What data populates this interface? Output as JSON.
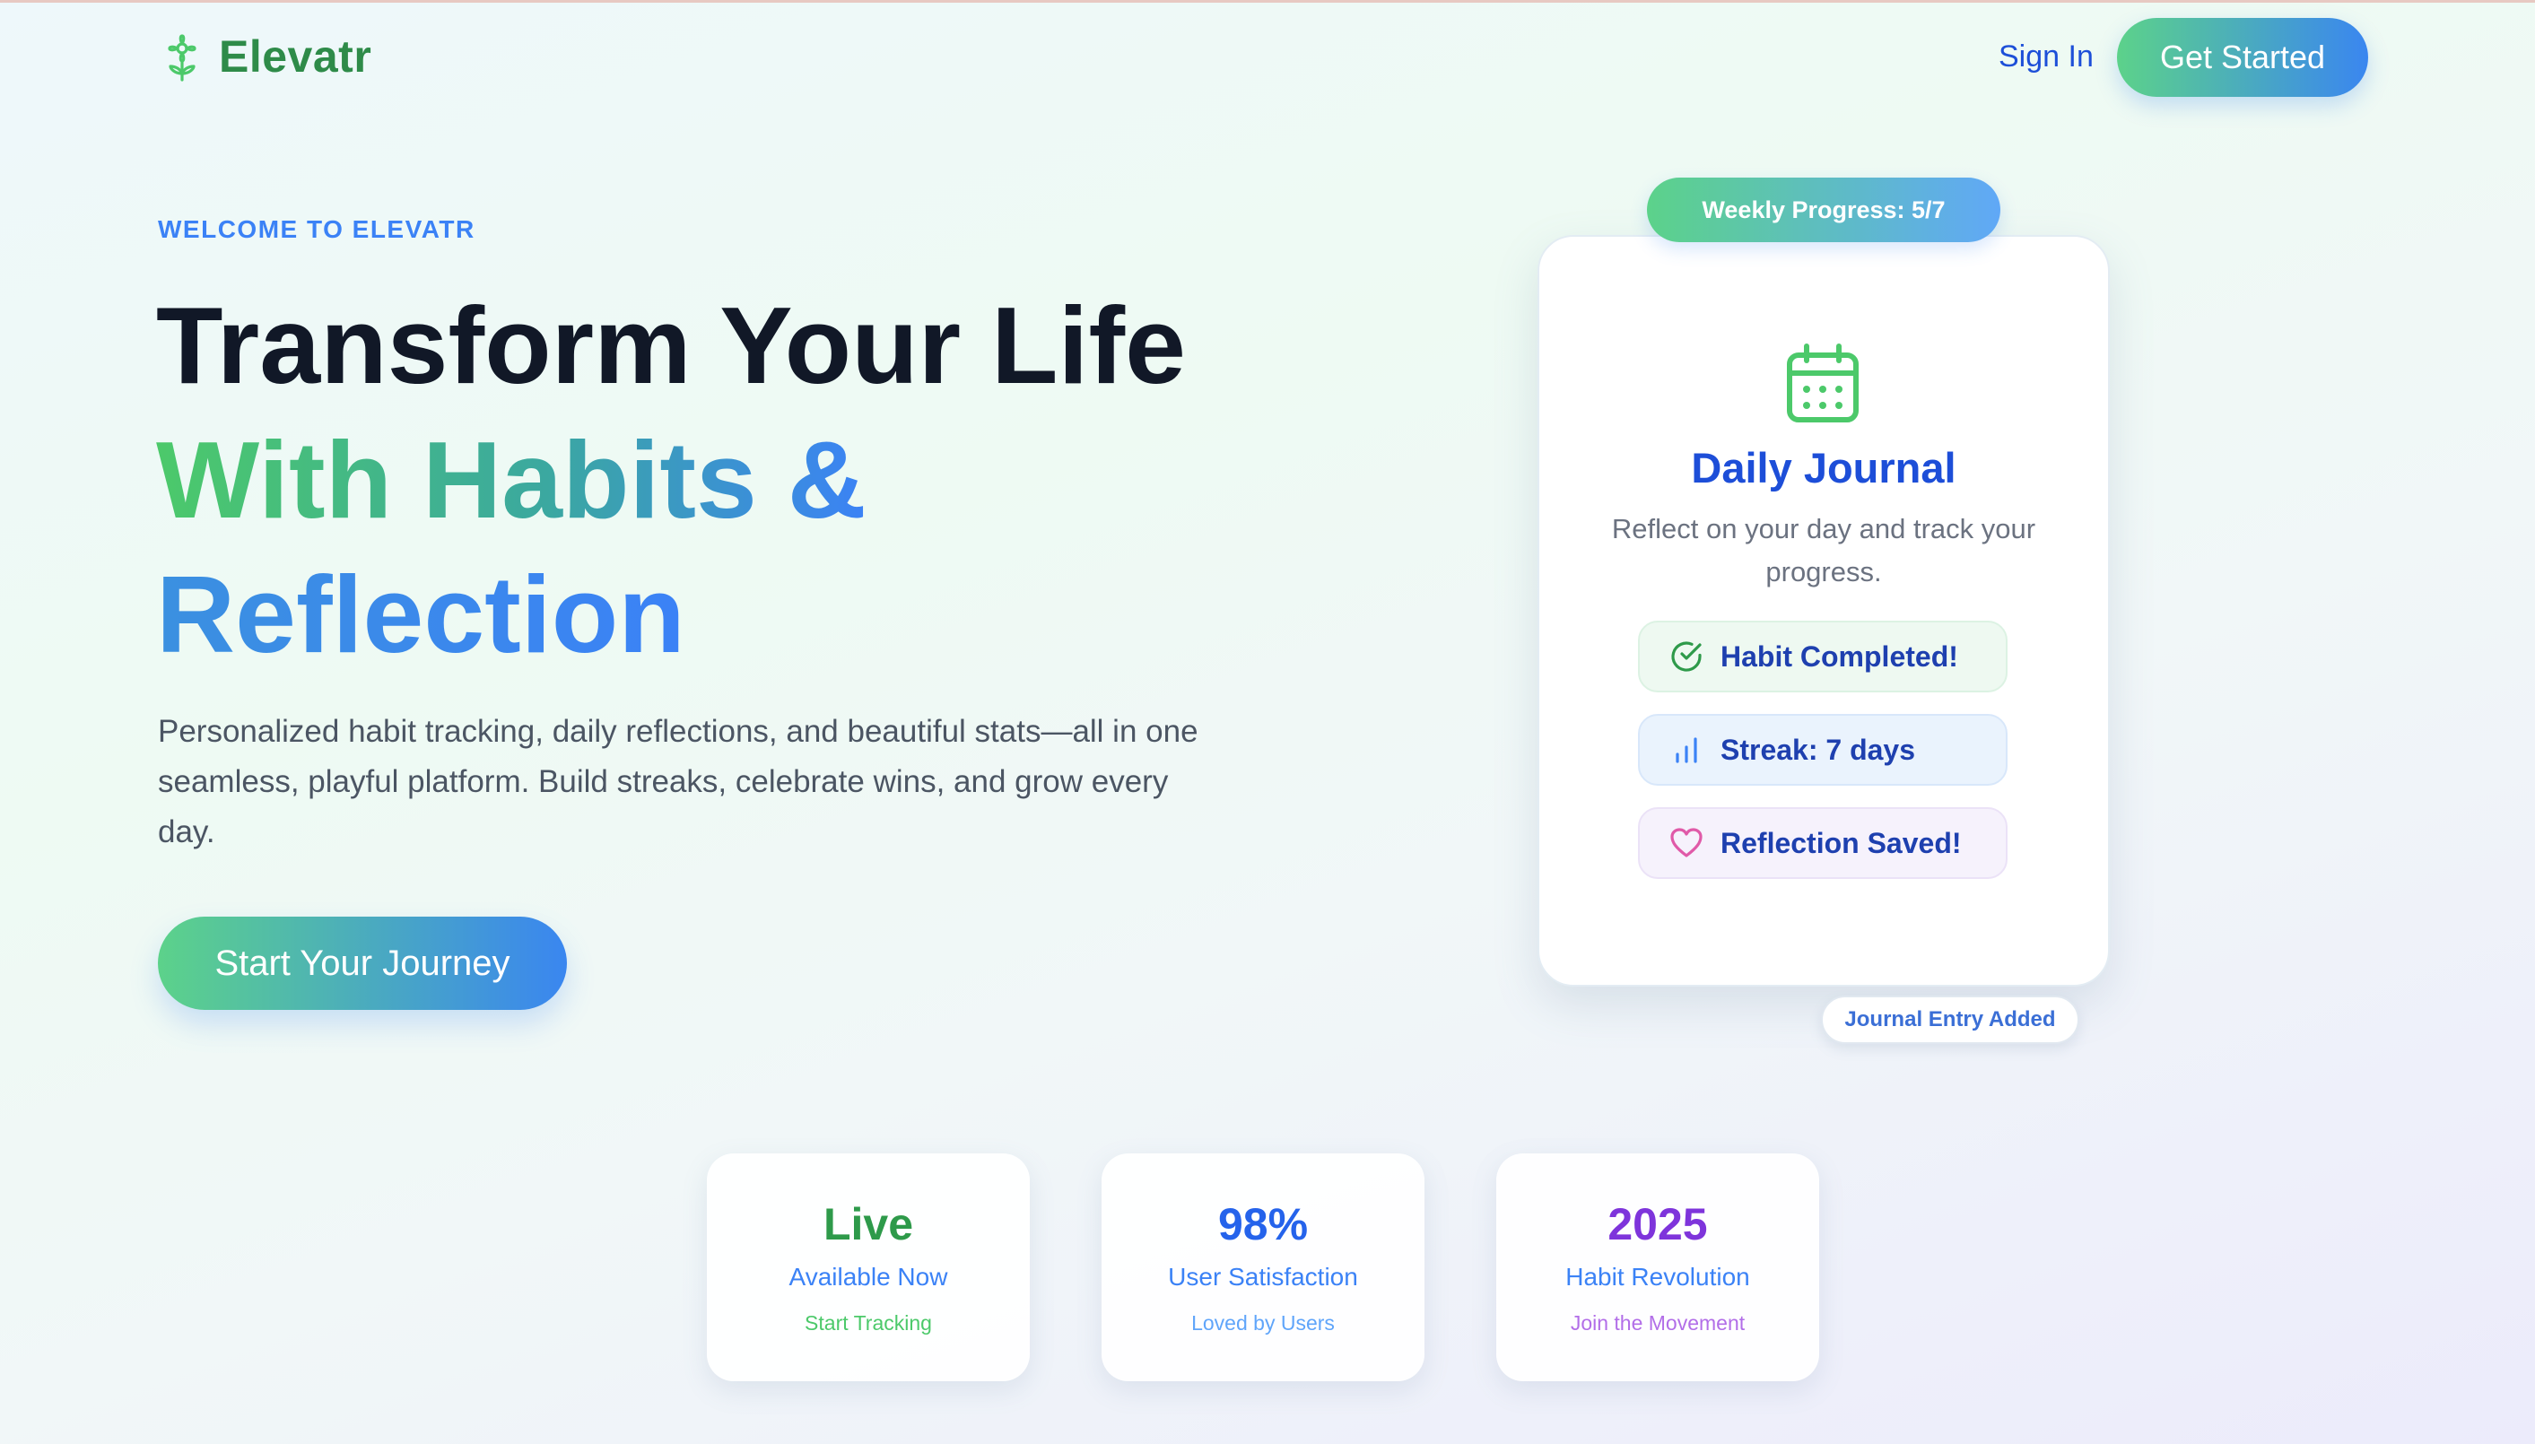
{
  "app": {
    "name": "Elevatr"
  },
  "nav": {
    "signin_label": "Sign In",
    "get_started_label": "Get Started"
  },
  "hero": {
    "eyebrow": "WELCOME TO ELEVATR",
    "headline_line1": "Transform Your Life",
    "headline_line2": "With Habits &",
    "headline_line3": "Reflection",
    "description": "Personalized habit tracking, daily reflections, and beautiful stats—all in one seamless, playful platform. Build streaks, celebrate wins, and grow every day.",
    "cta_label": "Start Your Journey"
  },
  "card": {
    "weekly_badge": "Weekly Progress: 5/7",
    "icon": "calendar-icon",
    "title": "Daily Journal",
    "description": "Reflect on your day and track your progress.",
    "pills": [
      {
        "icon": "check-circle-icon",
        "label": "Habit Completed!"
      },
      {
        "icon": "bar-chart-icon",
        "label": "Streak: 7 days"
      },
      {
        "icon": "heart-icon",
        "label": "Reflection Saved!"
      }
    ],
    "footer_badge": "Journal Entry Added"
  },
  "stats": [
    {
      "value": "Live",
      "label": "Available Now",
      "sub": "Start Tracking"
    },
    {
      "value": "98%",
      "label": "User Satisfaction",
      "sub": "Loved by Users"
    },
    {
      "value": "2025",
      "label": "Habit Revolution",
      "sub": "Join the Movement"
    }
  ],
  "colors": {
    "brand_green": "#2e8b49",
    "accent_blue": "#3b82f6",
    "accent_purple": "#7e34db"
  }
}
